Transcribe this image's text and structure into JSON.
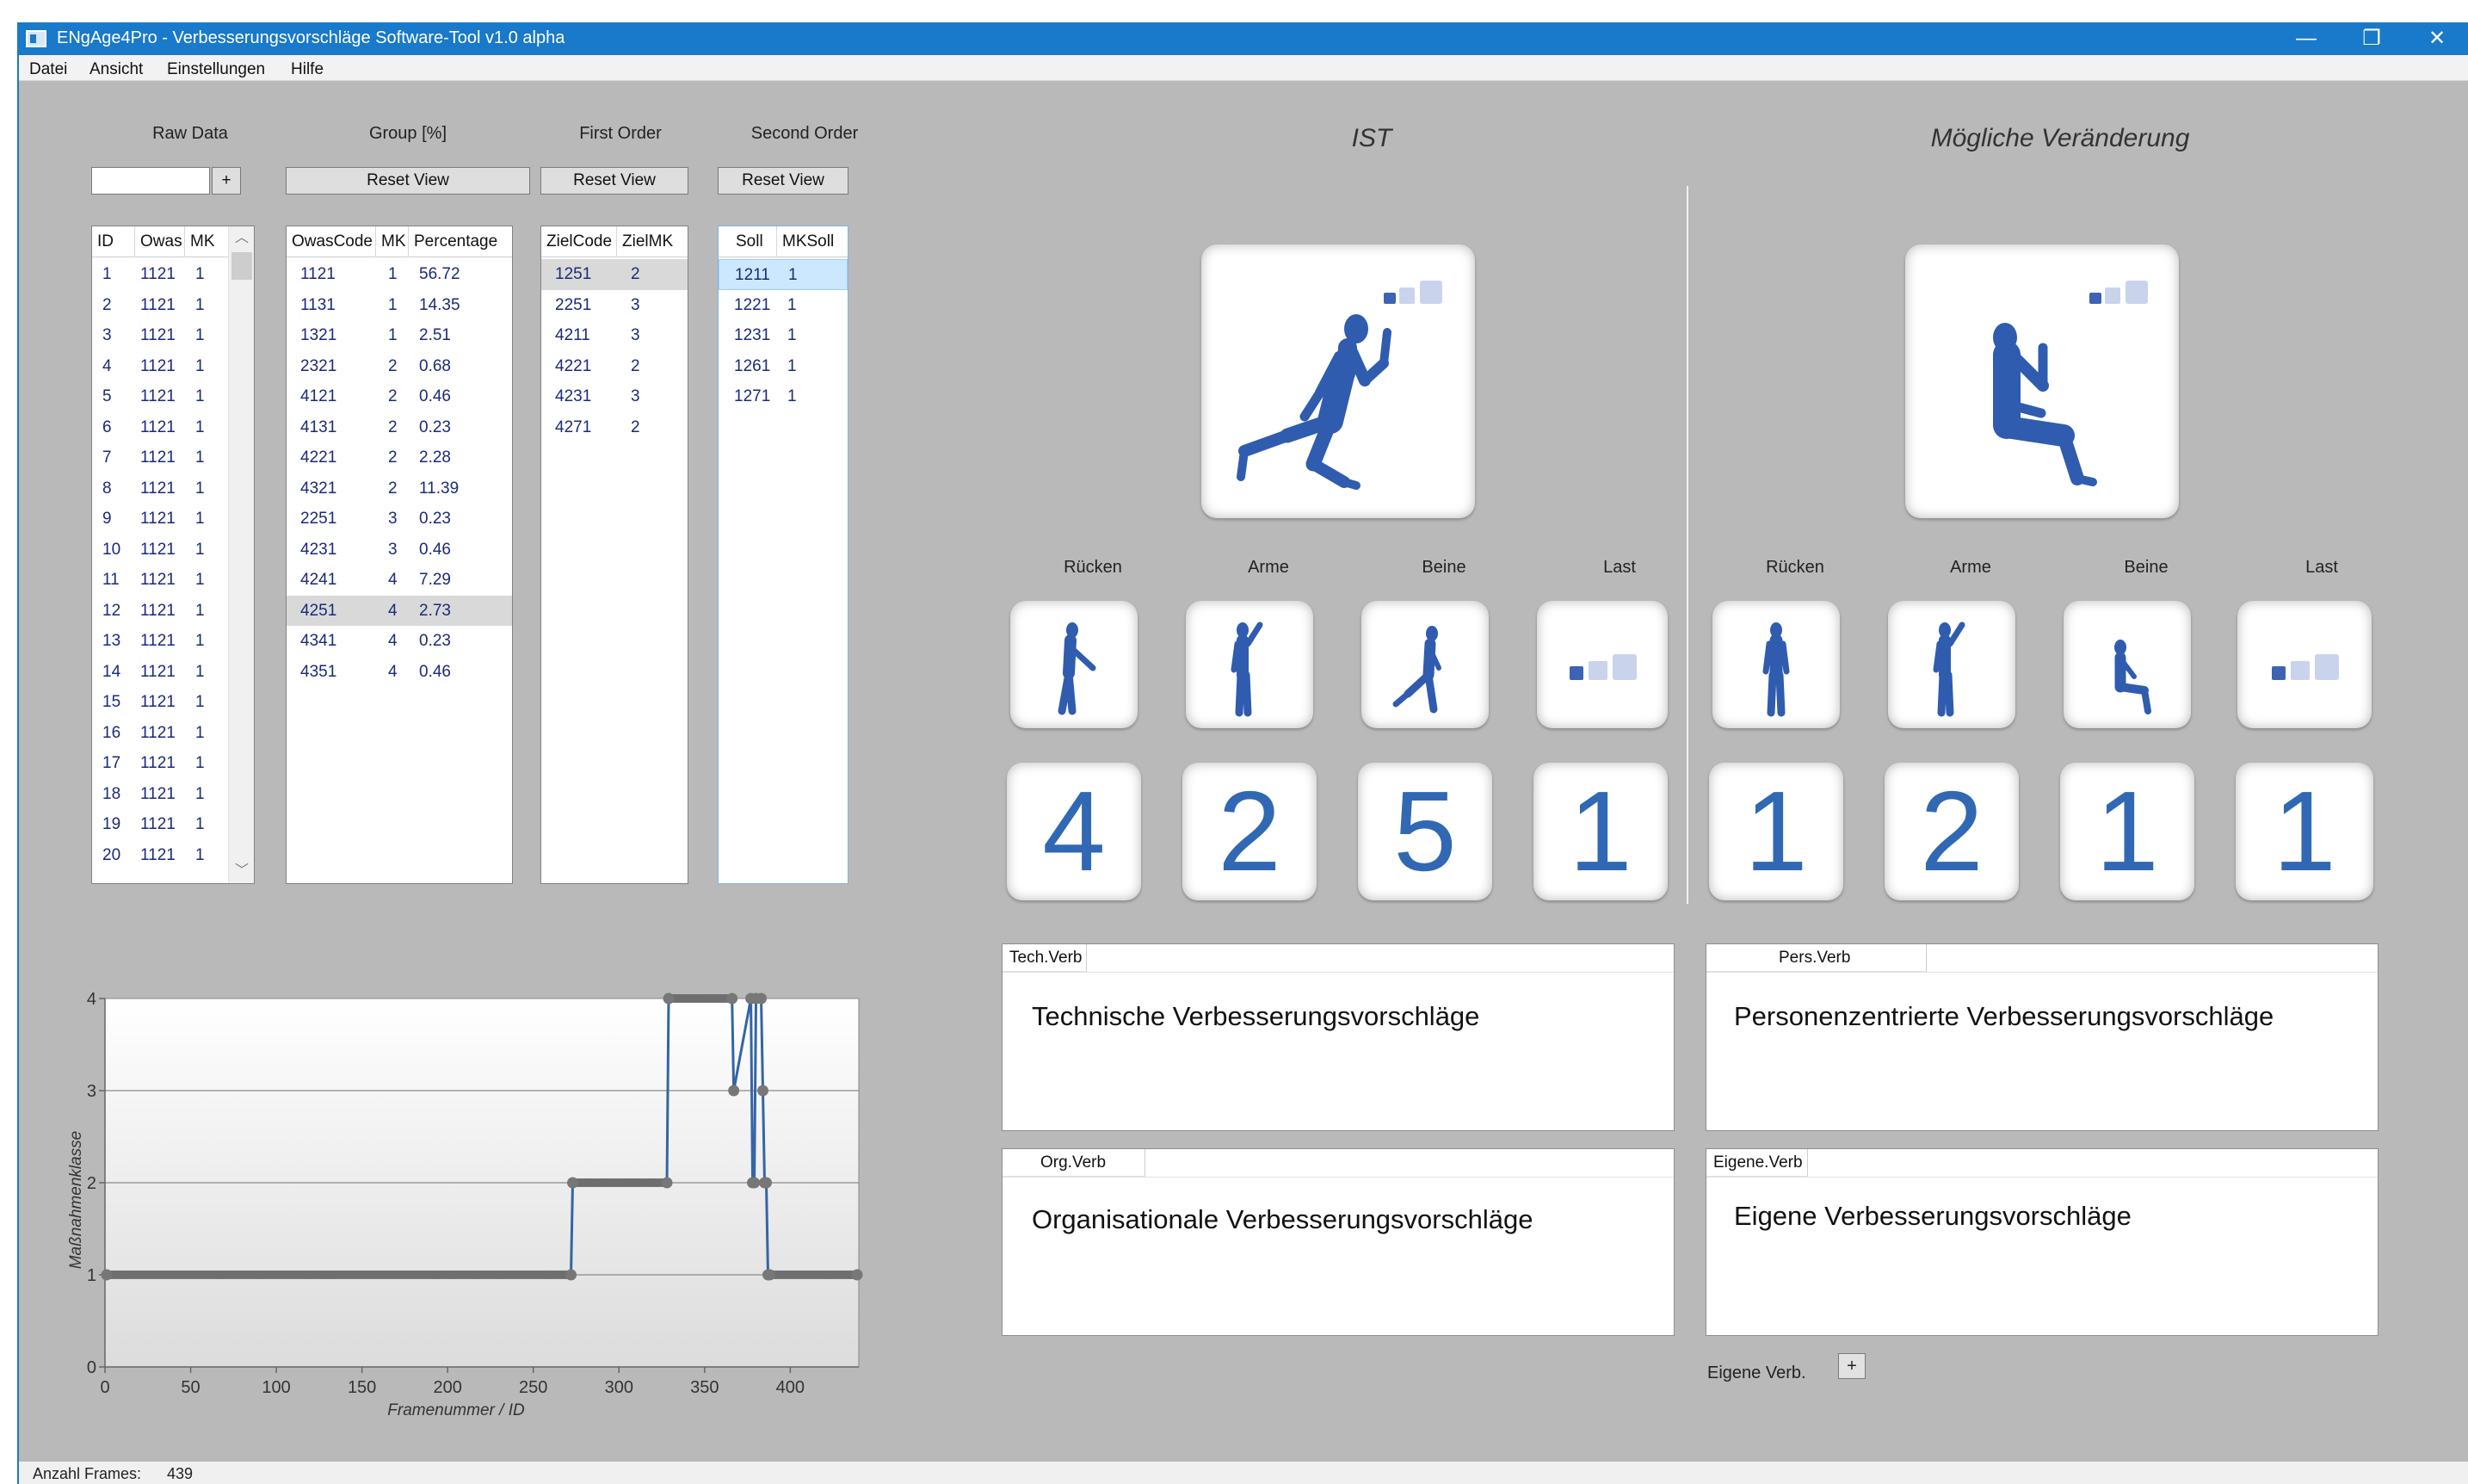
{
  "window": {
    "title": "ENgAge4Pro - Verbesserungsvorschläge Software-Tool v1.0 alpha",
    "controls": {
      "minimize": "—",
      "maximize": "❐",
      "close": "✕"
    },
    "accent_color": "#1979ca"
  },
  "menu": [
    "Datei",
    "Ansicht",
    "Einstellungen",
    "Hilfe"
  ],
  "panels": {
    "raw": {
      "label": "Raw Data",
      "input_value": "",
      "add_label": "+",
      "headers": [
        "ID",
        "Owas",
        "MK"
      ],
      "rows": [
        [
          "1",
          "1121",
          "1"
        ],
        [
          "2",
          "1121",
          "1"
        ],
        [
          "3",
          "1121",
          "1"
        ],
        [
          "4",
          "1121",
          "1"
        ],
        [
          "5",
          "1121",
          "1"
        ],
        [
          "6",
          "1121",
          "1"
        ],
        [
          "7",
          "1121",
          "1"
        ],
        [
          "8",
          "1121",
          "1"
        ],
        [
          "9",
          "1121",
          "1"
        ],
        [
          "10",
          "1121",
          "1"
        ],
        [
          "11",
          "1121",
          "1"
        ],
        [
          "12",
          "1121",
          "1"
        ],
        [
          "13",
          "1121",
          "1"
        ],
        [
          "14",
          "1121",
          "1"
        ],
        [
          "15",
          "1121",
          "1"
        ],
        [
          "16",
          "1121",
          "1"
        ],
        [
          "17",
          "1121",
          "1"
        ],
        [
          "18",
          "1121",
          "1"
        ],
        [
          "19",
          "1121",
          "1"
        ],
        [
          "20",
          "1121",
          "1"
        ]
      ],
      "scroll_up": "︿",
      "scroll_down": "﹀"
    },
    "group": {
      "label": "Group [%]",
      "reset_label": "Reset View",
      "headers": [
        "OwasCode",
        "MK",
        "Percentage"
      ],
      "rows": [
        [
          "1121",
          "1",
          "56.72"
        ],
        [
          "1131",
          "1",
          "14.35"
        ],
        [
          "1321",
          "1",
          "2.51"
        ],
        [
          "2321",
          "2",
          "0.68"
        ],
        [
          "4121",
          "2",
          "0.46"
        ],
        [
          "4131",
          "2",
          "0.23"
        ],
        [
          "4221",
          "2",
          "2.28"
        ],
        [
          "4321",
          "2",
          "11.39"
        ],
        [
          "2251",
          "3",
          "0.23"
        ],
        [
          "4231",
          "3",
          "0.46"
        ],
        [
          "4241",
          "4",
          "7.29"
        ],
        [
          "4251",
          "4",
          "2.73"
        ],
        [
          "4341",
          "4",
          "0.23"
        ],
        [
          "4351",
          "4",
          "0.46"
        ]
      ],
      "selected_row": 11
    },
    "first": {
      "label": "First Order",
      "reset_label": "Reset View",
      "headers": [
        "ZielCode",
        "ZielMK"
      ],
      "rows": [
        [
          "1251",
          "2"
        ],
        [
          "2251",
          "3"
        ],
        [
          "4211",
          "3"
        ],
        [
          "4221",
          "2"
        ],
        [
          "4231",
          "3"
        ],
        [
          "4271",
          "2"
        ]
      ],
      "selected_row": 0
    },
    "second": {
      "label": "Second Order",
      "reset_label": "Reset View",
      "headers": [
        "Soll",
        "MKSoll"
      ],
      "rows": [
        [
          "1211",
          "1"
        ],
        [
          "1221",
          "1"
        ],
        [
          "1231",
          "1"
        ],
        [
          "1261",
          "1"
        ],
        [
          "1271",
          "1"
        ]
      ],
      "selected_row": 0
    }
  },
  "ist": {
    "heading": "IST",
    "column_labels": [
      "Rücken",
      "Arme",
      "Beine",
      "Last"
    ],
    "scores": [
      "4",
      "2",
      "5",
      "1"
    ]
  },
  "change": {
    "heading": "Mögliche Veränderung",
    "column_labels": [
      "Rücken",
      "Arme",
      "Beine",
      "Last"
    ],
    "scores": [
      "1",
      "2",
      "1",
      "1"
    ]
  },
  "suggestions": {
    "tech": {
      "tab": "Tech.Verb",
      "text": "Technische Verbesserungsvorschläge"
    },
    "pers": {
      "tab": "Pers.Verb",
      "text": "Personenzentrierte Verbesserungsvorschläge"
    },
    "org": {
      "tab": "Org.Verb",
      "text": "Organisationale Verbesserungsvorschläge"
    },
    "eigene": {
      "tab": "Eigene.Verb",
      "text": "Eigene Verbesserungsvorschläge"
    }
  },
  "eigene_add": {
    "label": "Eigene Verb.",
    "button": "+"
  },
  "status": {
    "label": "Anzahl Frames:",
    "value": "439"
  },
  "figure_color": "#2f5cae",
  "icon_names": [
    "human-figure-icon",
    "weights-icon"
  ],
  "chart_data": {
    "type": "line",
    "xlabel": "Framenummer / ID",
    "ylabel": "Maßnahmenklasse",
    "xlim": [
      0,
      440
    ],
    "ylim": [
      0,
      4
    ],
    "xticks": [
      0,
      50,
      100,
      150,
      200,
      250,
      300,
      350,
      400
    ],
    "yticks": [
      0,
      1,
      2,
      3,
      4
    ],
    "grid": true,
    "series": [
      {
        "x": [
          1,
          272,
          273,
          328,
          329,
          366,
          367,
          377,
          378,
          379,
          380,
          383,
          384,
          385,
          386,
          387,
          388,
          439
        ],
        "y": [
          1,
          1,
          2,
          2,
          4,
          4,
          3,
          4,
          2,
          2,
          4,
          4,
          3,
          2,
          2,
          1,
          1,
          1
        ]
      }
    ]
  }
}
